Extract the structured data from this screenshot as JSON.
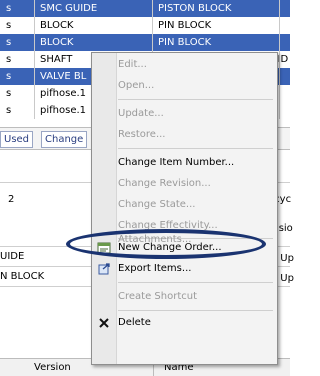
{
  "table": {
    "rows": [
      {
        "c0": "s",
        "c1": "SMC GUIDE",
        "c2": "PISTON BLOCK",
        "c3": "",
        "selected": true
      },
      {
        "c0": "s",
        "c1": "BLOCK",
        "c2": "PIN BLOCK",
        "c3": "",
        "selected": false
      },
      {
        "c0": "s",
        "c1": "BLOCK",
        "c2": "PIN BLOCK",
        "c3": "",
        "selected": true
      },
      {
        "c0": "s",
        "c1": "SHAFT",
        "c2": "",
        "c3": "LID",
        "selected": false
      },
      {
        "c0": "s",
        "c1": "VALVE BL",
        "c2": "",
        "c3": "",
        "selected": true
      },
      {
        "c0": "s",
        "c1": "pifhose.1",
        "c2": "",
        "c3": "",
        "selected": false
      },
      {
        "c0": "s",
        "c1": "pifhose.1",
        "c2": "",
        "c3": "",
        "selected": false
      }
    ]
  },
  "tabs": [
    "Used",
    "Change"
  ],
  "lower": {
    "left_labels": [
      "2",
      "UIDE",
      "N BLOCK"
    ],
    "right_labels": [
      "ecyc",
      "visio",
      "st Up",
      "st Up"
    ],
    "header_version": "Version",
    "header_name": "Name"
  },
  "menu": {
    "items": [
      {
        "label": "Edit...",
        "enabled": false,
        "icon": ""
      },
      {
        "label": "Open...",
        "enabled": false,
        "icon": ""
      },
      {
        "label": "Update...",
        "enabled": false,
        "icon": ""
      },
      {
        "label": "Restore...",
        "enabled": false,
        "icon": ""
      },
      {
        "label": "Change Item Number...",
        "enabled": true,
        "icon": ""
      },
      {
        "label": "Change Revision...",
        "enabled": false,
        "icon": ""
      },
      {
        "label": "Change State...",
        "enabled": false,
        "icon": ""
      },
      {
        "label": "Change Effectivity...",
        "enabled": false,
        "icon": ""
      },
      {
        "label": "Attachments...",
        "enabled": false,
        "icon": ""
      },
      {
        "label": "New Change Order...",
        "enabled": true,
        "icon": "change-order-icon"
      },
      {
        "label": "Export Items...",
        "enabled": true,
        "icon": "export-icon"
      },
      {
        "label": "Create Shortcut",
        "enabled": false,
        "icon": ""
      },
      {
        "label": "Delete",
        "enabled": true,
        "icon": "delete-x-icon"
      }
    ]
  },
  "colors": {
    "selection": "#3a63b6",
    "highlight_oval": "#1a3370"
  }
}
